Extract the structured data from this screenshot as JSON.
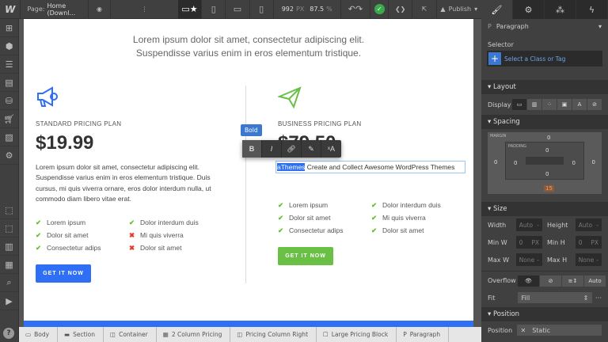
{
  "topbar": {
    "logo": "W",
    "page_label": "Page:",
    "page_name": "Home (Downl...",
    "width": "992",
    "width_unit": "PX",
    "zoom": "87.5",
    "zoom_unit": "%",
    "publish": "Publish"
  },
  "canvas": {
    "intro_line1": "Lorem ipsum dolor sit amet, consectetur adipiscing elit.",
    "intro_line2": "Suspendisse varius enim in eros elementum tristique.",
    "left": {
      "plan": "STANDARD PRICING PLAN",
      "price": "$19.99",
      "desc": "Lorem ipsum dolor sit amet, consectetur adipiscing elit. Suspendisse varius enim in eros elementum tristique. Duis cursus, mi quis viverra ornare, eros dolor interdum nulla, ut commodo diam libero vitae erat.",
      "features": [
        {
          "t": "Lorem ipsum",
          "ok": true
        },
        {
          "t": "Dolor interdum duis",
          "ok": true
        },
        {
          "t": "Dolor sit amet",
          "ok": true
        },
        {
          "t": "Mi quis viverra",
          "ok": false
        },
        {
          "t": "Consectetur adips",
          "ok": true
        },
        {
          "t": "Dolor sit amet",
          "ok": false
        }
      ],
      "button": "GET IT NOW",
      "button_color": "#2f6ff5"
    },
    "right": {
      "plan": "BUSINESS PRICING PLAN",
      "price": "$79.50",
      "selected_word": "aThemes",
      "paragraph_rest": " Create and Collect Awesome WordPress Themes",
      "features": [
        {
          "t": "Lorem ipsum",
          "ok": true
        },
        {
          "t": "Dolor interdum duis",
          "ok": true
        },
        {
          "t": "Dolor sit amet",
          "ok": true
        },
        {
          "t": "Mi quis viverra",
          "ok": true
        },
        {
          "t": "Consectetur adips",
          "ok": true
        },
        {
          "t": "Dolor sit amet",
          "ok": true
        }
      ],
      "button": "GET IT NOW",
      "button_color": "#6abf45"
    },
    "tooltip": "Bold"
  },
  "breadcrumbs": [
    "Body",
    "Section",
    "Container",
    "2 Column Pricing",
    "Pricing Column Right",
    "Large Pricing Block",
    "Paragraph"
  ],
  "panel": {
    "element_tag": "P",
    "element_name": "Paragraph",
    "selector_label": "Selector",
    "selector_placeholder": "Select a Class or Tag",
    "layout": "Layout",
    "display": "Display",
    "spacing": "Spacing",
    "margin": "MARGIN",
    "padding": "PADDING",
    "margin_vals": {
      "top": "0",
      "right": "0",
      "bottom": "15",
      "left": "0"
    },
    "padding_vals": {
      "top": "0",
      "right": "0",
      "bottom": "0",
      "left": "0"
    },
    "size": "Size",
    "width": "Width",
    "width_val": "Auto",
    "height": "Height",
    "height_val": "Auto",
    "minw": "Min W",
    "minw_val": "0",
    "minh": "Min H",
    "minh_val": "0",
    "unit": "PX",
    "maxw": "Max W",
    "maxw_val": "None",
    "maxh": "Max H",
    "maxh_val": "None",
    "overflow": "Overflow",
    "overflow_auto": "Auto",
    "fit": "Fit",
    "fit_val": "Fill",
    "position_section": "Position",
    "position": "Position",
    "position_val": "Static"
  }
}
